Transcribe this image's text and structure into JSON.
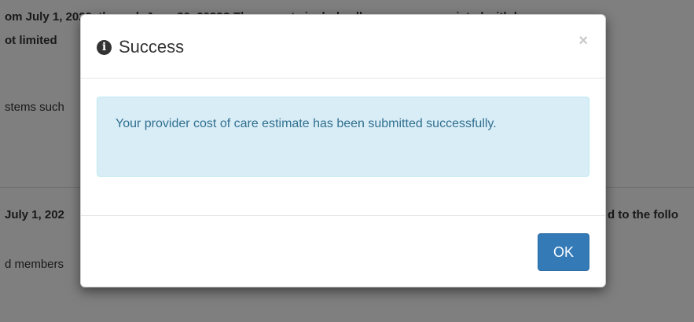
{
  "background": {
    "line1": "om July 1, 2022, through June 30, 2023? These costs include all expenses associated with ke",
    "line2": "ot limited",
    "line3": "stems such",
    "line4_left": "July 1, 202",
    "line4_right": "d to the follo",
    "line5": "d members"
  },
  "modal": {
    "title": "Success",
    "close_symbol": "×",
    "info_icon_glyph": "i",
    "alert_text": "Your provider cost of care estimate has been submitted successfully.",
    "ok_label": "OK"
  },
  "colors": {
    "alert_bg": "#d9edf7",
    "alert_text": "#31708f",
    "primary_button": "#337ab7"
  }
}
